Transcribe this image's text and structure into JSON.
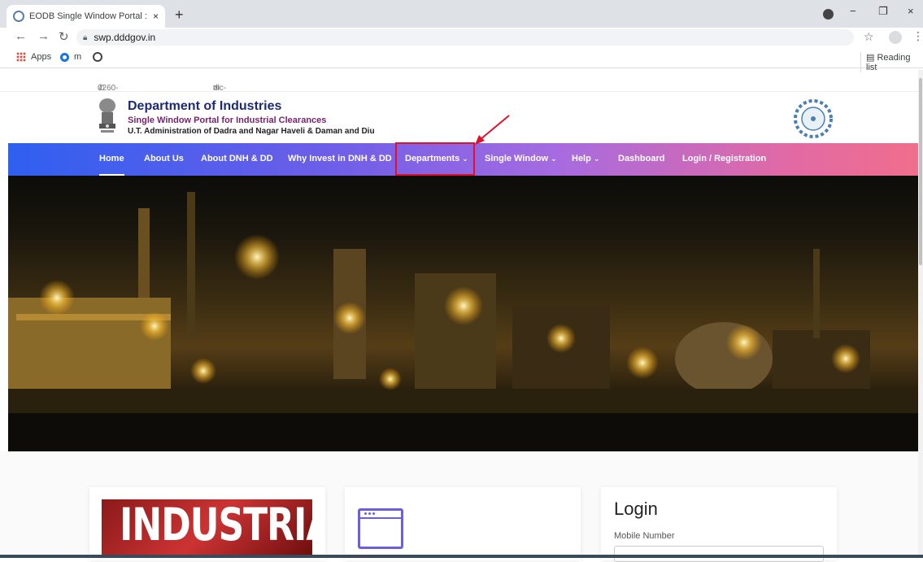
{
  "browser": {
    "tab_title": "EODB Single Window Portal : Da",
    "tab_close": "×",
    "new_tab": "+",
    "url": "swp.dddgov.in",
    "bookmarks": {
      "apps": "Apps",
      "m": "m"
    },
    "reading_list": "Reading list",
    "window_minimize": "−",
    "window_restore": "❐",
    "window_close": "×"
  },
  "contact": {
    "phone": "0260-2260310 / 2260871",
    "email": "dic-dd@nic.in"
  },
  "header": {
    "title": "Department of Industries",
    "subtitle": "Single Window Portal for Industrial Clearances",
    "admin": "U.T. Administration of Dadra and Nagar Haveli & Daman and Diu"
  },
  "nav": {
    "items": [
      {
        "label": "Home"
      },
      {
        "label": "About Us"
      },
      {
        "label": "About DNH & DD"
      },
      {
        "label": "Why Invest in DNH & DD"
      },
      {
        "label": "Departments"
      },
      {
        "label": "Single Window"
      },
      {
        "label": "Help"
      },
      {
        "label": "Dashboard"
      },
      {
        "label": "Login / Registration"
      }
    ]
  },
  "cards": {
    "industrial_banner": "INDUSTRIAL",
    "login": {
      "title": "Login",
      "mobile_label": "Mobile Number"
    }
  },
  "colors": {
    "nav_start": "#2f5ff0",
    "nav_end": "#f16e8c",
    "highlight": "#e0112a",
    "title": "#1b2a7a"
  }
}
